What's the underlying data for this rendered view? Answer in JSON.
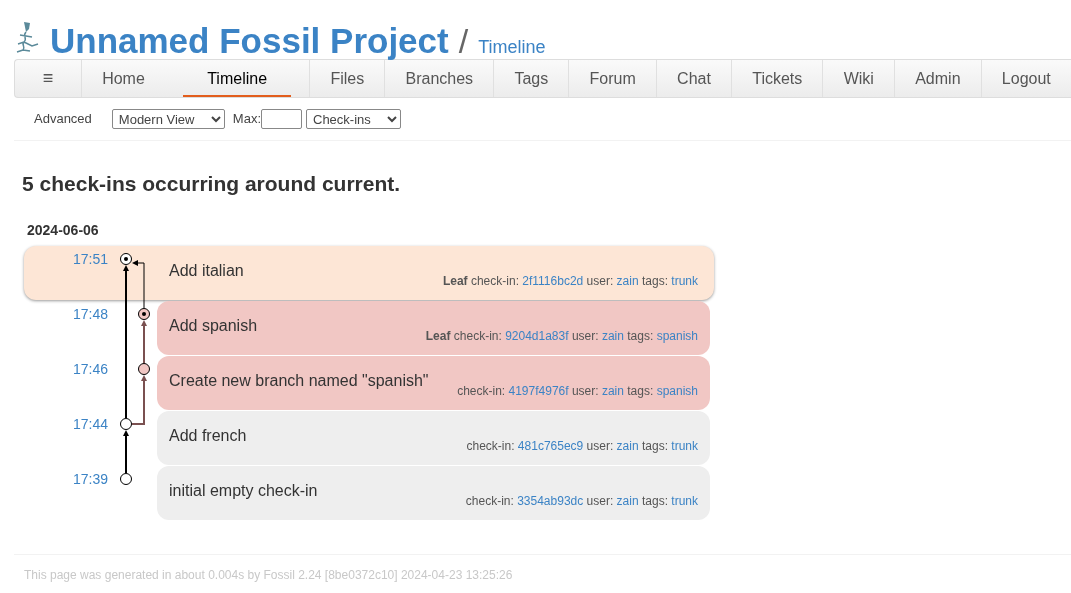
{
  "header": {
    "title": "Unnamed Fossil Project",
    "separator": "/",
    "subtitle": "Timeline"
  },
  "nav": [
    {
      "label": "≡",
      "kind": "menu",
      "selected": false
    },
    {
      "label": "Home",
      "kind": "link",
      "selected": false
    },
    {
      "label": "Timeline",
      "kind": "link",
      "selected": true
    },
    {
      "label": "Files",
      "kind": "link",
      "selected": false
    },
    {
      "label": "Branches",
      "kind": "link",
      "selected": false
    },
    {
      "label": "Tags",
      "kind": "link",
      "selected": false
    },
    {
      "label": "Forum",
      "kind": "link",
      "selected": false
    },
    {
      "label": "Chat",
      "kind": "link",
      "selected": false
    },
    {
      "label": "Tickets",
      "kind": "link",
      "selected": false
    },
    {
      "label": "Wiki",
      "kind": "link",
      "selected": false
    },
    {
      "label": "Admin",
      "kind": "link",
      "selected": false
    },
    {
      "label": "Logout",
      "kind": "link",
      "selected": false
    }
  ],
  "submenu": {
    "advanced": "Advanced",
    "view": "Modern View",
    "max_label": "Max:",
    "type": "Check-ins"
  },
  "heading": "5 check-ins occurring around current.",
  "date": "2024-06-06",
  "checkins": [
    {
      "time": "17:51",
      "comment": "Add italian",
      "info": "**Leaf** check-in:",
      "hash": "2f1116bc2d",
      "user_label": "user:",
      "user": "zain",
      "tags_label": "tags:",
      "tag": "trunk",
      "selected": true,
      "leaf": true,
      "kind": "trunk",
      "color": "#fde6d6"
    },
    {
      "time": "17:48",
      "comment": "Add spanish",
      "info": "**Leaf** check-in:",
      "hash": "9204d1a83f",
      "user_label": "user:",
      "user": "zain",
      "tags_label": "tags:",
      "tag": "spanish",
      "selected": false,
      "leaf": true,
      "kind": "branch",
      "color": "#f1c7c4"
    },
    {
      "time": "17:46",
      "comment": "Create new branch named \"spanish\"",
      "info": "check-in:",
      "hash": "4197f4976f",
      "user_label": "user:",
      "user": "zain",
      "tags_label": "tags:",
      "tag": "spanish",
      "selected": false,
      "leaf": false,
      "kind": "branch",
      "color": "#f1c7c4"
    },
    {
      "time": "17:44",
      "comment": "Add french",
      "info": "check-in:",
      "hash": "481c765ec9",
      "user_label": "user:",
      "user": "zain",
      "tags_label": "tags:",
      "tag": "trunk",
      "selected": false,
      "leaf": false,
      "kind": "trunk",
      "color": "#eeeeee"
    },
    {
      "time": "17:39",
      "comment": "initial empty check-in",
      "info": "check-in:",
      "hash": "3354ab93dc",
      "user_label": "user:",
      "user": "zain",
      "tags_label": "tags:",
      "tag": "trunk",
      "selected": false,
      "leaf": false,
      "kind": "trunk",
      "color": "#eeeeee"
    }
  ],
  "footer": "This page was generated in about 0.004s by Fossil 2.24 [8be0372c10] 2024-04-23 13:25:26"
}
